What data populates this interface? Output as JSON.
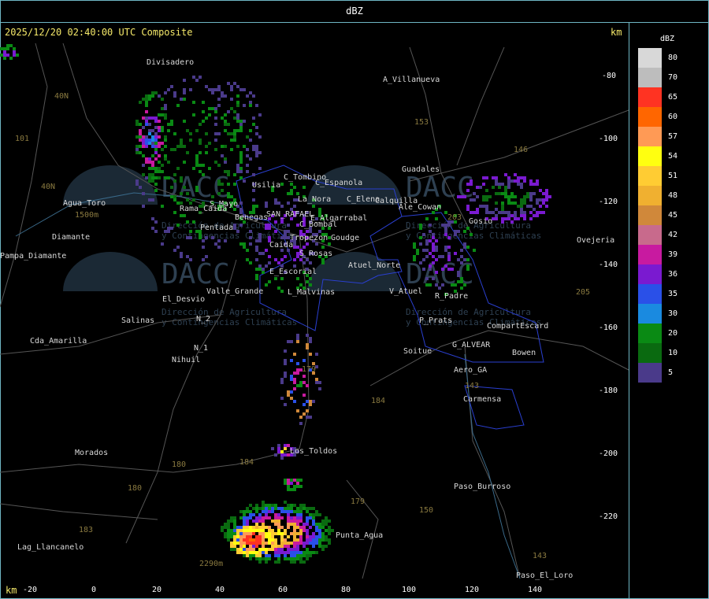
{
  "header": {
    "title": "dBZ"
  },
  "plot": {
    "timestamp": "2025/12/20 02:40:00 UTC Composite",
    "unit_top": "km",
    "unit_bottom": "km"
  },
  "axes": {
    "x_ticks": [
      "-20",
      "0",
      "20",
      "40",
      "60",
      "80",
      "100",
      "120",
      "140"
    ],
    "y_ticks": [
      "-80",
      "-100",
      "-120",
      "-140",
      "-160",
      "-180",
      "-200",
      "-220"
    ]
  },
  "legend": {
    "title": "dBZ",
    "entries": [
      {
        "label": "80",
        "color": "#d8d8d8"
      },
      {
        "label": "70",
        "color": "#bdbdbd"
      },
      {
        "label": "65",
        "color": "#ff3322"
      },
      {
        "label": "60",
        "color": "#ff6600"
      },
      {
        "label": "57",
        "color": "#ff9a55"
      },
      {
        "label": "54",
        "color": "#ffff10"
      },
      {
        "label": "51",
        "color": "#ffcc33"
      },
      {
        "label": "48",
        "color": "#f0b030"
      },
      {
        "label": "45",
        "color": "#d0883a"
      },
      {
        "label": "42",
        "color": "#c86a8c"
      },
      {
        "label": "39",
        "color": "#c81aa0"
      },
      {
        "label": "36",
        "color": "#7a1ad0"
      },
      {
        "label": "35",
        "color": "#2a50e8"
      },
      {
        "label": "30",
        "color": "#1a8ae0"
      },
      {
        "label": "20",
        "color": "#0a8a14"
      },
      {
        "label": "10",
        "color": "#0a6a10"
      },
      {
        "label": "5",
        "color": "#4a3a8a"
      }
    ]
  },
  "places": [
    "Divisadero",
    "A_Villanueva",
    "Guadales",
    "Gosio",
    "Ovejeria",
    "Agua_Toro",
    "Pampa_Diamante",
    "Diamante",
    "El_Desvio",
    "Salinas",
    "Cda_Amarilla",
    "Nihuil",
    "N_1",
    "N_2",
    "Valle_Grande",
    "L_Malvinas",
    "E_Escorial",
    "Atuel_Norte",
    "V_Atuel",
    "R_Padre",
    "P_Prats",
    "CompartEscard",
    "G_ALVEAR",
    "Bowen",
    "Soitue",
    "Aero_GA",
    "Carmensa",
    "Morados",
    "Los_Toldos",
    "Paso_Burroso",
    "Punta_Agua",
    "Paso_El_Loro",
    "Lag_Llancanelo",
    "Usilia",
    "C_Tombino",
    "C_Espanola",
    "La_Nora",
    "C_Elena",
    "Calquilla",
    "Ale_Cowan",
    "SAN_RAFAEL",
    "E_Algarrabal",
    "C_Bombal",
    "Tropezon",
    "Goudge",
    "Caida",
    "S_Rosas",
    "Pentada",
    "Benegas",
    "Rama_Caida",
    "S_Mayo"
  ],
  "routes": [
    "40N",
    "101",
    "153",
    "146",
    "40N",
    "203",
    "143",
    "205",
    "179",
    "184",
    "180",
    "184",
    "183",
    "180",
    "179",
    "150",
    "143",
    "2290m",
    "1500m"
  ],
  "watermark": {
    "brand": "DACC",
    "line1": "Dirección de Agricultura",
    "line2": "y Contingencias Climáticas"
  }
}
